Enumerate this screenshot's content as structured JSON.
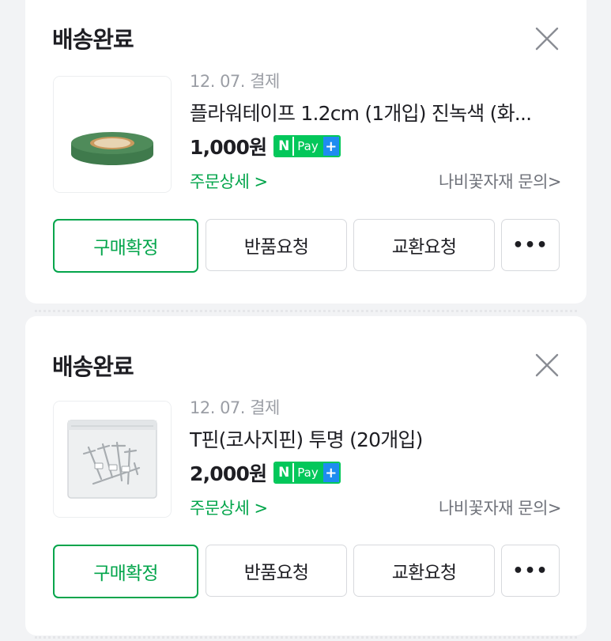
{
  "orders": [
    {
      "status": "배송완료",
      "pay_date": "12. 07. 결제",
      "product_name": "플라워테이프 1.2cm (1개입) 진녹색 (화...",
      "price": "1,000원",
      "npay": {
        "n": "N",
        "text": "Pay",
        "plus": "+"
      },
      "order_detail": "주문상세 >",
      "seller_inquiry": "나비꽃자재 문의>",
      "buttons": {
        "confirm": "구매확정",
        "return": "반품요청",
        "exchange": "교환요청",
        "more": "•••"
      }
    },
    {
      "status": "배송완료",
      "pay_date": "12. 07. 결제",
      "product_name": "T핀(코사지핀) 투명 (20개입)",
      "price": "2,000원",
      "npay": {
        "n": "N",
        "text": "Pay",
        "plus": "+"
      },
      "order_detail": "주문상세 >",
      "seller_inquiry": "나비꽃자재 문의>",
      "buttons": {
        "confirm": "구매확정",
        "return": "반품요청",
        "exchange": "교환요청",
        "more": "•••"
      }
    }
  ],
  "icons": {
    "close": "close-icon",
    "product_1": "green-tape-roll-image",
    "product_2": "t-pin-bag-image"
  },
  "colors": {
    "accent_green": "#03a54b",
    "npay_green": "#03c75a",
    "npay_blue": "#1e8cf0",
    "muted_text": "#9b9ea5"
  }
}
